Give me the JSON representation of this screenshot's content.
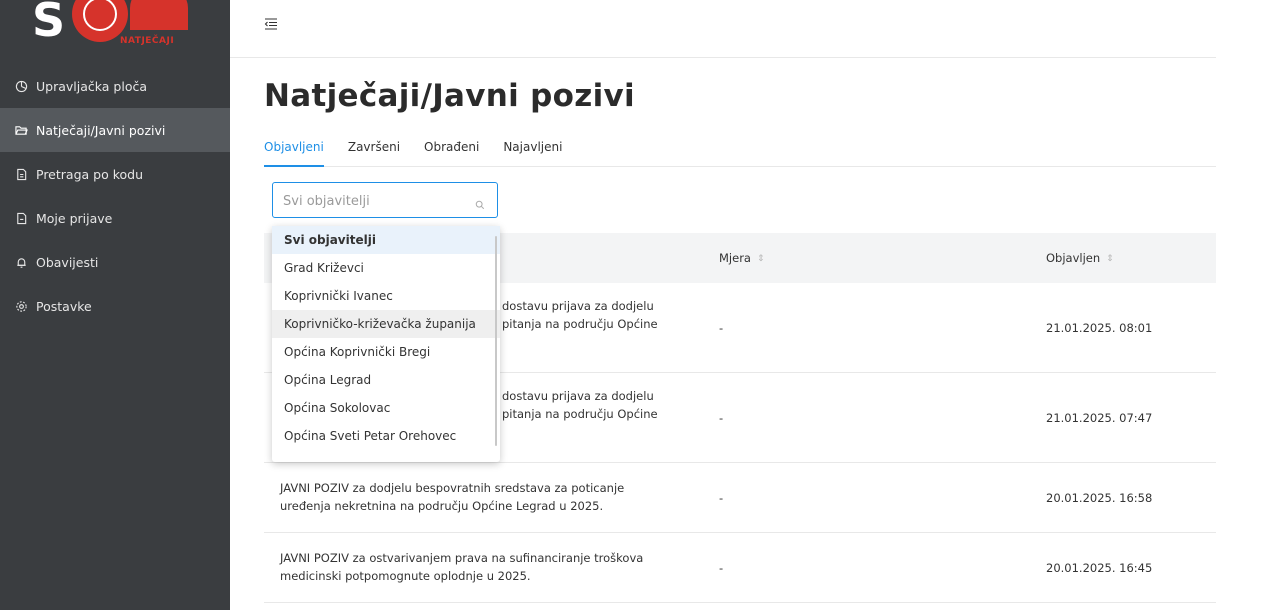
{
  "logo": {
    "text": "NATJEČAJI"
  },
  "sidebar": {
    "items": [
      {
        "label": "Upravljačka ploča",
        "icon": "dashboard-icon"
      },
      {
        "label": "Natječaji/Javni pozivi",
        "icon": "folder-open-icon"
      },
      {
        "label": "Pretraga po kodu",
        "icon": "document-icon"
      },
      {
        "label": "Moje prijave",
        "icon": "file-icon"
      },
      {
        "label": "Obavijesti",
        "icon": "bell-icon"
      },
      {
        "label": "Postavke",
        "icon": "gear-icon"
      }
    ]
  },
  "page": {
    "title": "Natječaji/Javni pozivi"
  },
  "tabs": [
    {
      "label": "Objavljeni"
    },
    {
      "label": "Završeni"
    },
    {
      "label": "Obrađeni"
    },
    {
      "label": "Najavljeni"
    }
  ],
  "search": {
    "placeholder": "Svi objavitelji",
    "value": ""
  },
  "dropdown": {
    "options": [
      "Svi objavitelji",
      "Grad Križevci",
      "Koprivnički Ivanec",
      "Koprivničko-križevačka županija",
      "Općina Koprivnički Bregi",
      "Općina Legrad",
      "Općina Sokolovac",
      "Općina Sveti Petar Orehovec"
    ]
  },
  "table": {
    "headers": {
      "mjera": "Mjera",
      "objavljen": "Objavljen"
    },
    "rows": [
      {
        "title_line1": "JAVNI POZIV za dostavu prijava za dodjelu",
        "title_line2": "... pitanja na području Općine",
        "title_visible_1": "dostavu prijava za dodjelu",
        "title_visible_2": "pitanja na području Općine",
        "mjera": "-",
        "date": "21.01.2025. 08:01"
      },
      {
        "title_line1": "JAVNI POZIV za dostavu prijava za dodjelu",
        "title_line2": "... pitanja na području Općine",
        "title_visible_1": "dostavu prijava za dodjelu",
        "title_visible_2": "pitanja na području Općine",
        "mjera": "-",
        "date": "21.01.2025. 07:47"
      },
      {
        "title_line1": "JAVNI POZIV za dodjelu bespovratnih sredstava za poticanje",
        "title_line2": "uređenja nekretnina na području Općine Legrad u 2025.",
        "mjera": "-",
        "date": "20.01.2025. 16:58"
      },
      {
        "title_line1": "JAVNI POZIV za ostvarivanjem prava na sufinanciranje troškova",
        "title_line2": "medicinski potpomognute oplodnje u 2025.",
        "mjera": "-",
        "date": "20.01.2025. 16:45"
      }
    ]
  },
  "colors": {
    "accent": "#1e8fe6",
    "sidebar": "#3a3d40",
    "sidebar_active": "#55595d",
    "brand": "#d6332b"
  }
}
